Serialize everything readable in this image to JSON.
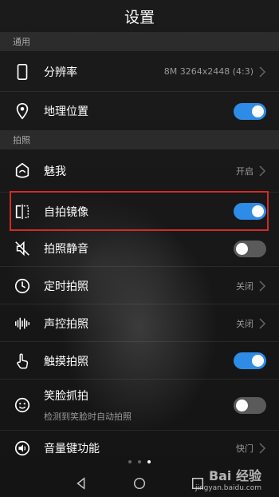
{
  "header": {
    "title": "设置"
  },
  "sections": {
    "general": "通用",
    "photo": "拍照"
  },
  "items": {
    "resolution": {
      "label": "分辨率",
      "value": "8M 3264x2448 (4:3)"
    },
    "location": {
      "label": "地理位置",
      "toggle": "on"
    },
    "beauty": {
      "label": "魅我",
      "value": "开启"
    },
    "mirror": {
      "label": "自拍镜像",
      "toggle": "on"
    },
    "mute": {
      "label": "拍照静音",
      "toggle": "off"
    },
    "timer": {
      "label": "定时拍照",
      "value": "关闭"
    },
    "voice": {
      "label": "声控拍照",
      "value": "关闭"
    },
    "touch": {
      "label": "触摸拍照",
      "toggle": "on"
    },
    "smile": {
      "label": "笑脸抓拍",
      "subtitle": "检测到笑脸时自动拍照",
      "toggle": "off"
    },
    "volume_key": {
      "label": "音量键功能",
      "value": "快门"
    }
  },
  "pager": {
    "pages": 3,
    "active": 3
  },
  "watermark": {
    "brand": "Bai 经验",
    "url": "jingyan.baidu.com"
  },
  "colors": {
    "toggle_on": "#2e8ce6",
    "toggle_off": "#5a5a5a",
    "highlight": "#d12a2a"
  }
}
